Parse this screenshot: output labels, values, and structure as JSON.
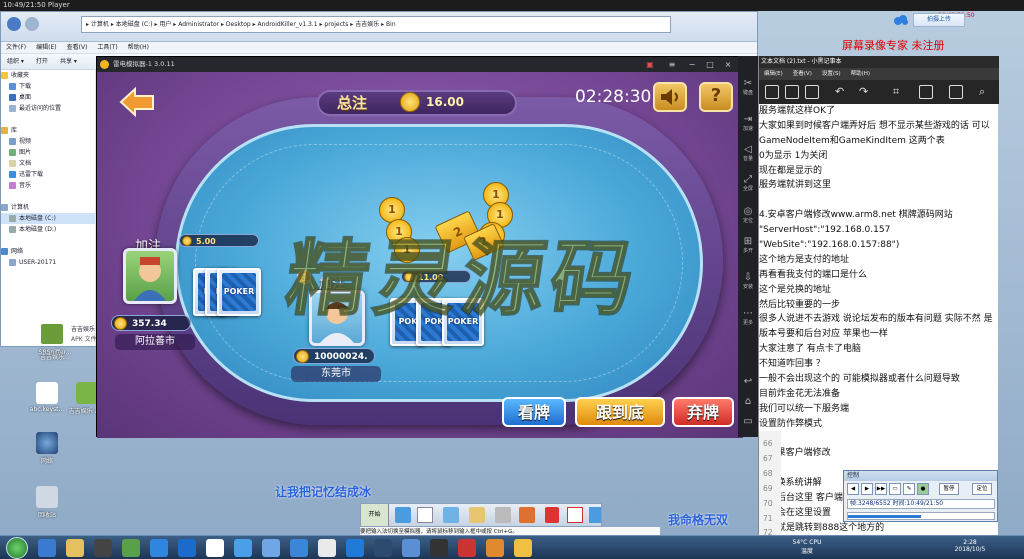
{
  "player_title": "10:49/21:50 Player",
  "recorder": {
    "time": "10:49/21:50",
    "upload_btn": "拍摄上传",
    "label": "屏幕录像专家 未注册"
  },
  "explorer": {
    "address": "▸ 计算机 ▸ 本地磁盘 (C:) ▸ 用户 ▸ Administrator ▸ Desktop ▸ AndroidKiller_v1.3.1 ▸ projects ▸ 吉吉娱乐 ▸ Bin",
    "menu": [
      "文件(F)",
      "编辑(E)",
      "查看(V)",
      "工具(T)",
      "帮助(H)"
    ],
    "toolbar": [
      "组织 ▾",
      "打开",
      "共享 ▾"
    ],
    "sidebar": [
      "收藏夹",
      "下载",
      "桌面",
      "最近访问的位置",
      "",
      "库",
      "视频",
      "图片",
      "文档",
      "迅雷下载",
      "音乐",
      "",
      "计算机",
      "本地磁盘 (C:)",
      "本地磁盘 (D:)",
      "",
      "网络",
      "USER-20171"
    ],
    "status": [
      "吉吉娱乐",
      "APK 文件"
    ]
  },
  "emulator": {
    "title": "雷电模拟器-1 3.0.11"
  },
  "game": {
    "total_label": "总注",
    "total_value": "16.00",
    "clock": "02:28:30",
    "help": "?",
    "players": [
      {
        "name": "阿拉善市",
        "coins": "357.34",
        "bet": "5.00",
        "action": "加注",
        "card_text": [
          "PO",
          "PO",
          "POKER"
        ]
      },
      {
        "name": "东莞市",
        "coins": "10000024.",
        "bet": "11.00",
        "action": "加注",
        "card_text": [
          "POK",
          "POK",
          "POKER"
        ]
      }
    ],
    "chip_values": [
      "1",
      "1",
      "1",
      "1",
      "1",
      "1",
      "2",
      "2"
    ],
    "buttons": {
      "look": "看牌",
      "follow": "跟到底",
      "fold": "弃牌"
    }
  },
  "emulator_right": [
    "键盘",
    "加速",
    "音量",
    "全屏",
    "定位",
    "多开",
    "安装",
    "更多"
  ],
  "notepad": {
    "title": "文本文档 (2).txt - 小黑记事本",
    "tabs": [
      "编辑(E)",
      "查看(V)",
      "设置(S)",
      "帮助(H)"
    ],
    "lines": [
      "服务端就这样OK了",
      "大家如果到时候客户端弄好后 想不显示某些游戏的话 可以",
      "GameNodeItem和GameKindItem 这两个表",
      "0为显示 1为关闭",
      "现在都是显示的",
      "服务端就讲到这里",
      "",
      "4.安卓客户端修改www.arm8.net 棋牌源码网站",
      "\"ServerHost\":\"192.168.0.157",
      "\"WebSite\":\"192.168.0.157:88\")",
      "这个地方是支付的地址",
      "再看看我支付的端口是什么",
      "这个是兑换的地址",
      "然后比较重要的一步",
      "很多人说进不去游戏 说论坛发布的版本有问题 实际不然 是",
      "版本号要和后台对应 苹果也一样",
      "大家注意了 有点卡了电脑",
      "不知道咋回事 ？",
      "一般不会出现这个的 可能模拟器或者什么问题导致",
      "目前炸金花无法准备",
      "我们可以统一下服务端",
      "设置防作弊模式",
      "",
      "5.苹果客户端修改",
      "",
      "6.兑换系统讲解",
      "兑换后台这里 客户端",
      "设置会在这里设置",
      "这里就是跳转到888这个地方的"
    ],
    "line_numbers": [
      "66",
      "67",
      "68",
      "69",
      "70",
      "71",
      "72"
    ]
  },
  "control_panel": {
    "title": "控制",
    "stop": "暂停",
    "go": "定位",
    "status": "帧:3248/6552 时间:10:49/21:50"
  },
  "chat": [
    "让我把记忆结成冰",
    "我命格无双"
  ],
  "watermark": "精灵源码",
  "desktop_icons": [
    "SRSniffer...",
    "吉吉娱乐...",
    "abc.keyst...",
    "吉吉娱乐\napk",
    "网络",
    "回收站"
  ],
  "inner_taskbar": {
    "start": "开始",
    "ime": "要把输入法切换至模拟器，请将鼠标移到输入框中或按 Ctrl+G。"
  },
  "tray": {
    "temp": "54°C\nCPU温度",
    "time": "2:28",
    "date": "2018/10/5"
  },
  "colors": {
    "felt": "#4aa8d8",
    "rail": "#7b5aa6",
    "look_btn": "#2f8be0",
    "follow_btn": "#f0a21b",
    "fold_btn": "#e0403a"
  }
}
